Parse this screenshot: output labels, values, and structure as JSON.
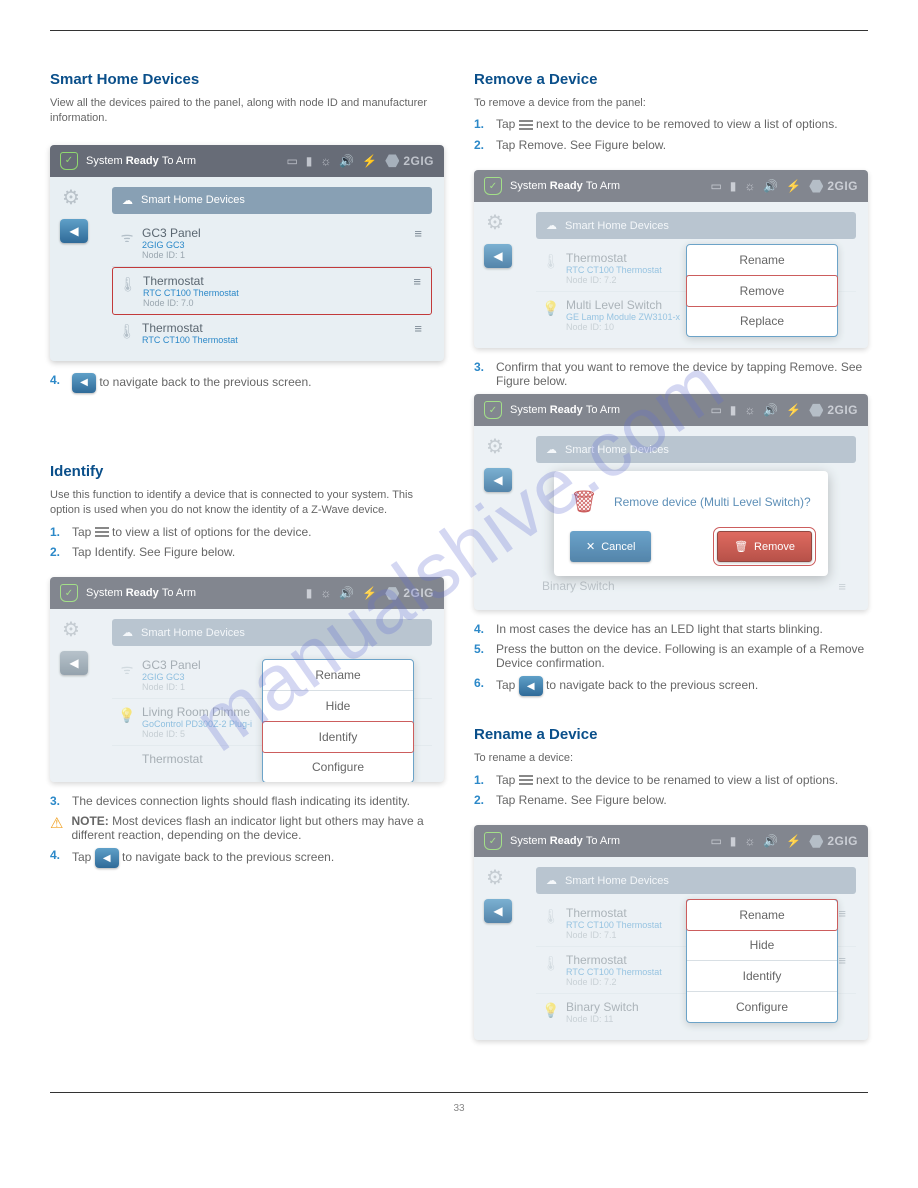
{
  "watermark": "manualshive.com",
  "page_number": "33",
  "shared": {
    "top_status_prefix": "System ",
    "top_status_bold": "Ready ",
    "top_status_suffix": "To Arm",
    "logo": "2GIG",
    "section_header": "Smart Home Devices"
  },
  "left": {
    "blockA": {
      "heading": "Smart Home Devices",
      "para": "View all the devices paired to the panel, along with node ID and manufacturer information."
    },
    "panel1": {
      "rows": [
        {
          "icon": "☁",
          "name": "GC3 Panel",
          "sub": "2GIG GC3",
          "node": "Node ID: 1"
        },
        {
          "icon": "🌡",
          "name": "Thermostat",
          "sub": "RTC CT100 Thermostat",
          "node": "Node ID: 7.0",
          "selected": true
        },
        {
          "icon": "🌡",
          "name": "Thermostat",
          "sub": "RTC CT100 Thermostat",
          "node": ""
        }
      ]
    },
    "stepsA": [
      {
        "n": "4.",
        "text": "  to navigate back to the previous screen."
      }
    ],
    "blockB": {
      "heading": "Identify",
      "p1": "Use this function to identify a device that is connected to your system. This option is used when you do not know the identity of a Z-Wave device.",
      "p2_a": "Tap ",
      "p2_b": " to view a list of options for the device.",
      "s2": "Tap Identify. See Figure below."
    },
    "panel2": {
      "rows": [
        {
          "icon": "☁",
          "name": "GC3 Panel",
          "sub": "2GIG GC3",
          "node": "Node ID: 1"
        },
        {
          "icon": "💡",
          "name": "Living Room Dimme",
          "sub": "GoControl PD300Z-2 Plug-i",
          "node": "Node ID: 5"
        },
        {
          "icon": "",
          "name": "Thermostat",
          "sub": "",
          "node": ""
        }
      ],
      "menu": [
        "Rename",
        "Hide",
        "Identify",
        "Configure"
      ],
      "menu_hl_index": 2
    },
    "followB": {
      "s3": "The devices connection lights should flash indicating its identity.",
      "note_label": "NOTE:",
      "note_text": "Most devices flash an indicator light but others may have a different reaction, depending on the device.",
      "s4_a": "Tap ",
      "s4_b": " to navigate back to the previous screen."
    }
  },
  "right": {
    "blockRemove": {
      "heading": "Remove a Device",
      "intro": "To remove a device from the panel:",
      "s1_a": "Tap ",
      "s1_b": " next to the device to be removed to view a list of options.",
      "s2": "Tap Remove. See Figure below."
    },
    "panelR1": {
      "rows": [
        {
          "icon": "🌡",
          "name": "Thermostat",
          "sub": "RTC CT100 Thermostat",
          "node": "Node ID: 7.2"
        },
        {
          "icon": "💡",
          "name": "Multi Level Switch",
          "sub": "GE Lamp Module ZW3101-x",
          "node": "Node ID: 10"
        }
      ],
      "menu": [
        "Rename",
        "Remove",
        "Replace"
      ],
      "menu_hl_index": 1
    },
    "s3r": "Confirm that you want to remove the device by tapping Remove. See Figure below.",
    "panelR2": {
      "dialog_msg": "Remove device (Multi Level Switch)?",
      "cancel": "Cancel",
      "remove": "Remove",
      "bottom_row": {
        "name": "Binary Switch"
      }
    },
    "s4r": "In most cases the device has an LED light that starts blinking.",
    "s5r": "Press the button on the device. Following is an example of a Remove Device confirmation.",
    "s6r_a": "Tap ",
    "s6r_b": " to navigate back to the previous screen.",
    "blockRename": {
      "heading": "Rename a Device",
      "intro": "To rename a device:",
      "s1_a": "Tap ",
      "s1_b": " next to the device to be renamed to view a list of options.",
      "s2": "Tap Rename. See Figure below."
    },
    "panelR3": {
      "rows": [
        {
          "icon": "🌡",
          "name": "Thermostat",
          "sub": "RTC CT100 Thermostat",
          "node": "Node ID: 7.1"
        },
        {
          "icon": "🌡",
          "name": "Thermostat",
          "sub": "RTC CT100 Thermostat",
          "node": "Node ID: 7.2"
        },
        {
          "icon": "💡",
          "name": "Binary Switch",
          "sub": "",
          "node": "Node ID: 11"
        }
      ],
      "menu": [
        "Rename",
        "Hide",
        "Identify",
        "Configure"
      ],
      "menu_hl_index": 0
    }
  }
}
